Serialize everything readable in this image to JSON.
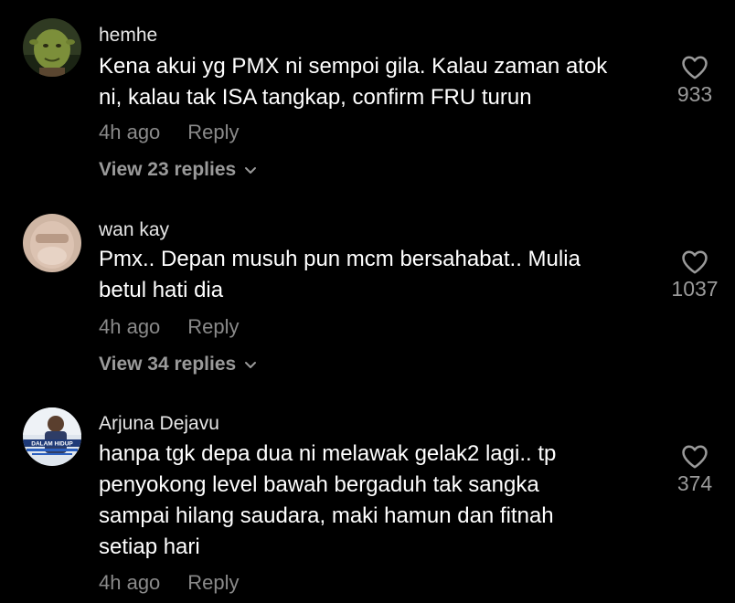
{
  "comments": [
    {
      "username": "hemhe",
      "text_lines": [
        "Kena akui yg PMX ni sempoi gila. Kalau zaman atok",
        "ni, kalau tak ISA tangkap, confirm FRU turun"
      ],
      "time": "4h ago",
      "reply_label": "Reply",
      "view_replies": "View 23 replies",
      "likes": "933",
      "avatar": "green-character-avatar"
    },
    {
      "username": "wan kay",
      "text_lines": [
        "Pmx.. Depan musuh pun mcm bersahabat.. Mulia",
        "betul hati dia"
      ],
      "time": "4h ago",
      "reply_label": "Reply",
      "view_replies": "View 34 replies",
      "likes": "1037",
      "avatar": "covered-face-avatar"
    },
    {
      "username": "Arjuna Dejavu",
      "text_lines": [
        "hanpa tgk depa dua ni melawak gelak2 lagi.. tp",
        "penyokong level bawah bergaduh tak sangka",
        "sampai hilang saudara, maki hamun dan fitnah",
        "setiap hari"
      ],
      "time": "4h ago",
      "reply_label": "Reply",
      "likes": "374",
      "avatar": "person-poster-avatar",
      "avatar_text": "DALAM HIDUP"
    }
  ],
  "colors": {
    "background": "#000000",
    "text": "#ffffff",
    "muted": "#8a8a8a"
  }
}
